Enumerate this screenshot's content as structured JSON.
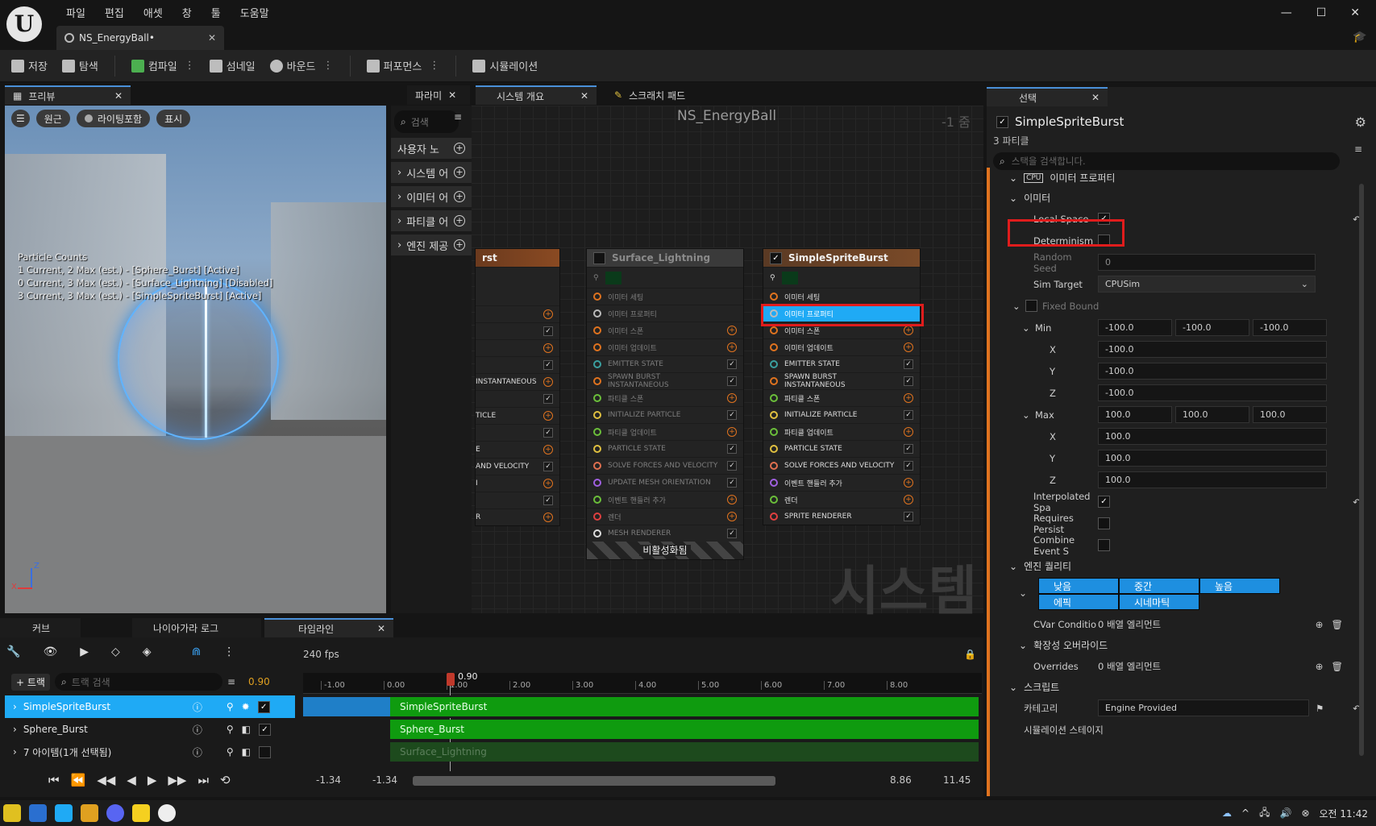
{
  "app": {
    "menu": [
      "파일",
      "편집",
      "애셋",
      "창",
      "툴",
      "도움말"
    ],
    "doc_tab": "NS_EnergyBall•"
  },
  "toolbar": {
    "save": "저장",
    "browse": "탐색",
    "compile": "컴파일",
    "thumbnail": "섬네일",
    "bounds": "바운드",
    "performance": "퍼포먼스",
    "simulation": "시뮬레이션"
  },
  "preview": {
    "tab": "프리뷰",
    "btn_perspective": "원근",
    "btn_lit": "라이팅포함",
    "btn_show": "표시",
    "particle_counts_title": "Particle Counts",
    "particle_counts": [
      "1 Current, 2 Max (est.) - [Sphere_Burst] [Active]",
      "0 Current, 3 Max (est.) - [Surface_Lightning] [Disabled]",
      "3 Current, 3 Max (est.) - [SimpleSpriteBurst] [Active]"
    ]
  },
  "palette": {
    "tab": "파라미",
    "search_placeholder": "검색",
    "items": [
      "사용자 노",
      "시스템 어",
      "이미터 어",
      "파티클 어",
      "엔진 제공"
    ]
  },
  "graph": {
    "tab_overview": "시스템 개요",
    "tab_scratch": "스크래치 패드",
    "title": "NS_EnergyBall",
    "zoom": "-1 줌",
    "watermark": "시스템",
    "left_node_title": "rst",
    "left_rows": [
      "",
      "",
      "",
      "",
      "INSTANTANEOUS",
      "",
      "TICLE",
      "",
      "E",
      "AND VELOCITY",
      "I",
      "",
      "R"
    ],
    "node_lightning": {
      "title": "Surface_Lightning",
      "disabled_label": "비활성화됨",
      "rows": [
        "이미터 세팅",
        "이미터 프로퍼티",
        "이미터 스폰",
        "이미터 업데이트",
        "EMITTER STATE",
        "SPAWN BURST INSTANTANEOUS",
        "파티클 스폰",
        "INITIALIZE PARTICLE",
        "파티클 업데이트",
        "PARTICLE STATE",
        "SOLVE FORCES AND VELOCITY",
        "UPDATE MESH ORIENTATION",
        "이벤트 핸들러 추가",
        "렌더",
        "MESH RENDERER"
      ]
    },
    "node_sprite": {
      "title": "SimpleSpriteBurst",
      "rows": [
        "이미터 세팅",
        "이미터 프로퍼티",
        "이미터 스폰",
        "이미터 업데이트",
        "EMITTER STATE",
        "SPAWN BURST INSTANTANEOUS",
        "파티클 스폰",
        "INITIALIZE PARTICLE",
        "파티클 업데이트",
        "PARTICLE STATE",
        "SOLVE FORCES AND VELOCITY",
        "이벤트 핸들러 추가",
        "렌더",
        "SPRITE RENDERER"
      ]
    }
  },
  "details": {
    "tab": "선택",
    "title": "SimpleSpriteBurst",
    "subtitle": "3 파티클",
    "search_placeholder": "스택을 검색합니다.",
    "section_emitter_props": "이미터 프로퍼티",
    "section_emitter": "이미터",
    "local_space": "Local Space",
    "determinism": "Determinism",
    "random_seed": "Random Seed",
    "random_seed_value": "0",
    "sim_target": "Sim Target",
    "sim_target_value": "CPUSim",
    "fixed_bound": "Fixed Bound",
    "min": "Min",
    "max": "Max",
    "min_values": [
      "-100.0",
      "-100.0",
      "-100.0"
    ],
    "max_values": [
      "100.0",
      "100.0",
      "100.0"
    ],
    "x": "X",
    "y": "Y",
    "z": "Z",
    "interpolated": "Interpolated Spa",
    "requires_persist": "Requires Persist",
    "combine_event": "Combine Event S",
    "section_engine_quality": "엔진 퀄리티",
    "quality": [
      "낮음",
      "중간",
      "높음",
      "에픽",
      "시네마틱"
    ],
    "cvar": "CVar Conditio",
    "cvar_value": "0 배열 엘리먼트",
    "section_scalability": "확장성 오버라이드",
    "overrides": "Overrides",
    "overrides_value": "0 배열 엘리먼트",
    "section_script": "스크립트",
    "category": "카테고리",
    "category_value": "Engine Provided",
    "sim_stage": "시뮬레이션 스테이지"
  },
  "timeline": {
    "tab_curve": "커브",
    "tab_log": "나이아가라 로그",
    "tab_timeline": "타임라인",
    "fps": "240 fps",
    "add_track": "+ 트랙",
    "track_search": "트랙 검색",
    "current_time": "0.90",
    "playhead_label": "0.90",
    "ruler": [
      "-1.00",
      "0.00",
      "1.00",
      "2.00",
      "3.00",
      "4.00",
      "5.00",
      "6.00",
      "7.00",
      "8.00"
    ],
    "tracks": [
      "SimpleSpriteBurst",
      "Sphere_Burst",
      "Surface_Lightning"
    ],
    "status": "7 아이템(1개 선택됨)",
    "range_left_1": "-1.34",
    "range_left_2": "-1.34",
    "range_right_1": "8.86",
    "range_right_2": "11.45"
  },
  "taskbar": {
    "clock": "오전 11:42"
  }
}
